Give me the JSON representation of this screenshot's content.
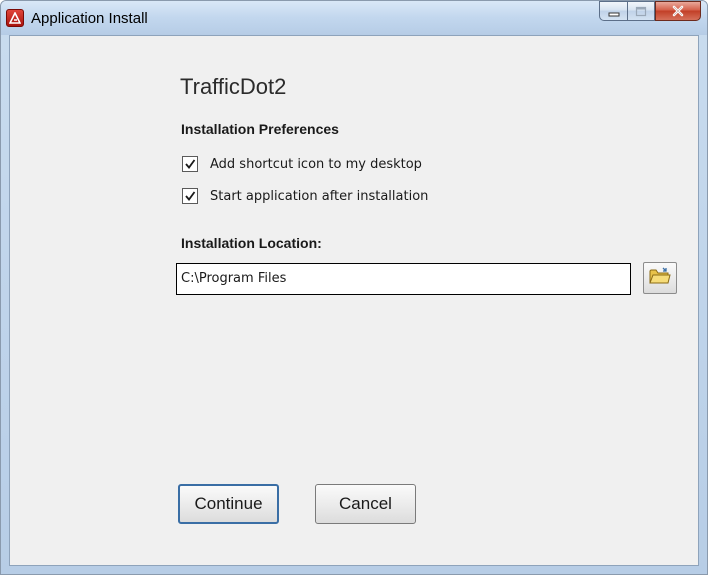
{
  "window": {
    "title": "Application Install",
    "title_icon": "adobe-air-icon"
  },
  "title_controls": {
    "minimize_icon": "minimize-icon",
    "maximize_icon": "maximize-icon",
    "close_icon": "close-icon"
  },
  "app": {
    "name": "TrafficDot2"
  },
  "preferences": {
    "heading": "Installation Preferences",
    "options": [
      {
        "label": "Add shortcut icon to my desktop",
        "checked": true
      },
      {
        "label": "Start application after installation",
        "checked": true
      }
    ]
  },
  "location": {
    "heading": "Installation Location:",
    "path": "C:\\Program Files",
    "browse_icon": "folder-icon"
  },
  "actions": {
    "continue_label": "Continue",
    "cancel_label": "Cancel"
  },
  "colors": {
    "client_bg": "#f0f0f0",
    "default_button_border": "#3a6ea5",
    "close_button": "#c23f27"
  }
}
